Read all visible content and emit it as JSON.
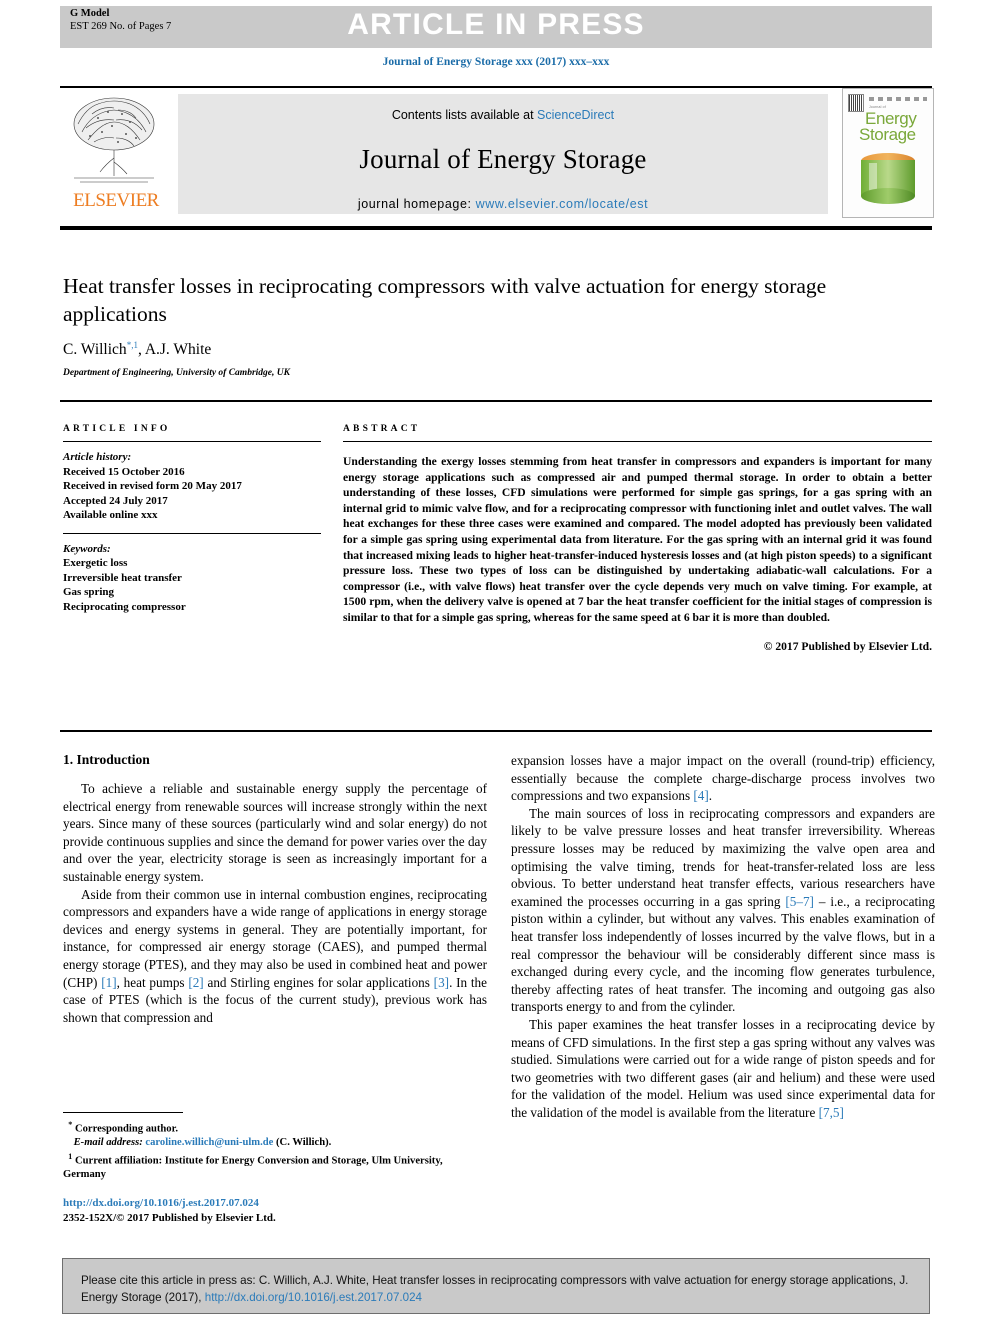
{
  "header": {
    "g_model": "G Model",
    "g_model_sub": "EST 269 No. of Pages 7",
    "article_in_press": "ARTICLE IN PRESS",
    "journal_ref": "Journal of Energy Storage xxx (2017) xxx–xxx"
  },
  "masthead": {
    "contents_prefix": "Contents lists available at ",
    "sciencedirect": "ScienceDirect",
    "journal_title": "Journal of Energy Storage",
    "homepage_prefix": "journal homepage: ",
    "homepage_url": "www.elsevier.com/locate/est",
    "publisher": "ELSEVIER",
    "cover": {
      "line1": "Energy",
      "line2": "Storage",
      "masthead_small": "Journal of"
    }
  },
  "article": {
    "title": "Heat transfer losses in reciprocating compressors with valve actuation for energy storage applications",
    "authors_part1": "C. Willich",
    "authors_sup": "*,1",
    "authors_part2": ", A.J. White",
    "affiliation": "Department of Engineering, University of Cambridge, UK"
  },
  "info": {
    "heading": "ARTICLE INFO",
    "history_label": "Article history:",
    "history": [
      "Received 15 October 2016",
      "Received in revised form 20 May 2017",
      "Accepted 24 July 2017",
      "Available online xxx"
    ],
    "keywords_label": "Keywords:",
    "keywords": [
      "Exergetic loss",
      "Irreversible heat transfer",
      "Gas spring",
      "Reciprocating compressor"
    ]
  },
  "abstract": {
    "heading": "ABSTRACT",
    "text": "Understanding the exergy losses stemming from heat transfer in compressors and expanders is important for many energy storage applications such as compressed air and pumped thermal storage. In order to obtain a better understanding of these losses, CFD simulations were performed for simple gas springs, for a gas spring with an internal grid to mimic valve flow, and for a reciprocating compressor with functioning inlet and outlet valves. The wall heat exchanges for these three cases were examined and compared. The model adopted has previously been validated for a simple gas spring using experimental data from literature. For the gas spring with an internal grid it was found that increased mixing leads to higher heat-transfer-induced hysteresis losses and (at high piston speeds) to a significant pressure loss. These two types of loss can be distinguished by undertaking adiabatic-wall calculations. For a compressor (i.e., with valve flows) heat transfer over the cycle depends very much on valve timing. For example, at 1500 rpm, when the delivery valve is opened at 7 bar the heat transfer coefficient for the initial stages of compression is similar to that for a simple gas spring, whereas for the same speed at 6 bar it is more than doubled.",
    "copyright": "© 2017 Published by Elsevier Ltd."
  },
  "body": {
    "section_heading": "1. Introduction",
    "left_p1": "To achieve a reliable and sustainable energy supply the percentage of electrical energy from renewable sources will increase strongly within the next years. Since many of these sources (particularly wind and solar energy) do not provide continuous supplies and since the demand for power varies over the day and over the year, electricity storage is seen as increasingly important for a sustainable energy system.",
    "left_p2_a": "Aside from their common use in internal combustion engines, reciprocating compressors and expanders have a wide range of applications in energy storage devices and energy systems in general. They are potentially important, for instance, for compressed air energy storage (CAES), and pumped thermal energy storage (PTES), and they may also be used in combined heat and power (CHP) ",
    "cite_1": "[1]",
    "left_p2_b": ", heat pumps ",
    "cite_2": "[2]",
    "left_p2_c": " and Stirling engines for solar applications ",
    "cite_3": "[3]",
    "left_p2_d": ". In the case of PTES (which is the focus of the current study), previous work has shown that compression and",
    "right_p1_a": "expansion losses have a major impact on the overall (round-trip) efficiency, essentially because the complete charge-discharge process involves two compressions and two expansions ",
    "cite_4": "[4]",
    "right_p1_b": ".",
    "right_p2_a": "The main sources of loss in reciprocating compressors and expanders are likely to be valve pressure losses and heat transfer irreversibility. Whereas pressure losses may be reduced by maximizing the valve open area and optimising the valve timing, trends for heat-transfer-related loss are less obvious. To better understand heat transfer effects, various researchers have examined the processes occurring in a gas spring ",
    "cite_57": "[5–7]",
    "right_p2_b": " – i.e., a reciprocating piston within a cylinder, but without any valves. This enables examination of heat transfer loss independently of losses incurred by the valve flows, but in a real compressor the behaviour will be considerably different since mass is exchanged during every cycle, and the incoming flow generates turbulence, thereby affecting rates of heat transfer. The incoming and outgoing gas also transports energy to and from the cylinder.",
    "right_p3_a": "This paper examines the heat transfer losses in a reciprocating device by means of CFD simulations. In the first step a gas spring without any valves was studied. Simulations were carried out for a wide range of piston speeds and for two geometries with two different gases (air and helium) and these were used for the validation of the model. Helium was used since experimental data for the validation of the model is available from the literature ",
    "cite_75": "[7,5]"
  },
  "footnotes": {
    "corresponding_marker": "*",
    "corresponding": "Corresponding author.",
    "email_label": "E-mail address:",
    "email": "caroline.willich@uni-ulm.de",
    "email_suffix": "(C. Willich).",
    "affil_marker": "1",
    "affil_note": "Current affiliation: Institute for Energy Conversion and Storage, Ulm University, Germany",
    "doi_url": "http://dx.doi.org/10.1016/j.est.2017.07.024",
    "issn_line": "2352-152X/© 2017 Published by Elsevier Ltd."
  },
  "cite_banner": {
    "text_before": "Please cite this article in press as: C. Willich, A.J. White, Heat transfer losses in reciprocating compressors with valve actuation for energy storage applications, J. Energy Storage (2017), ",
    "link": "http://dx.doi.org/10.1016/j.est.2017.07.024"
  },
  "colors": {
    "link": "#2b7bb9",
    "elsevier_orange": "#ED7D22",
    "banner_gray": "#c9c9c9"
  }
}
